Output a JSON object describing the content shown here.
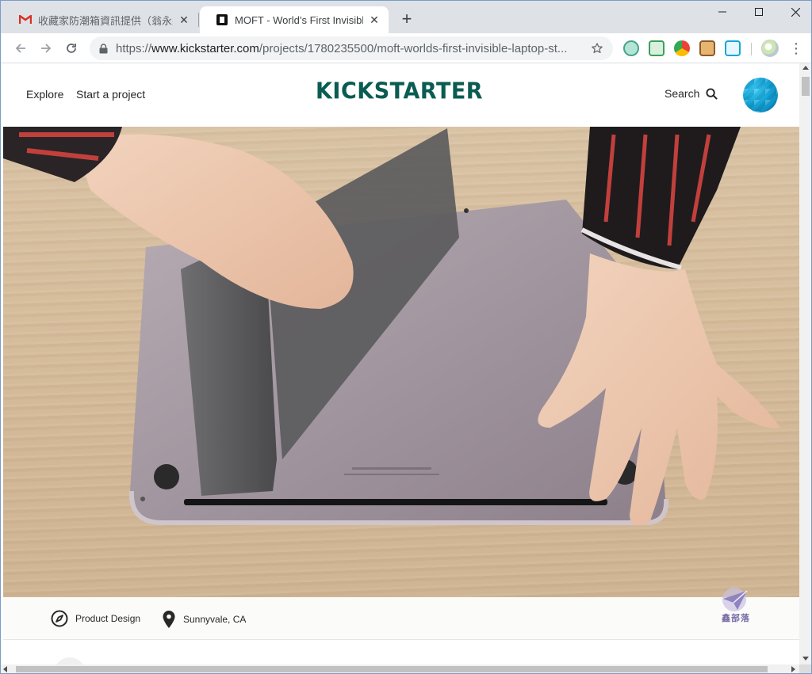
{
  "browser": {
    "tabs": [
      {
        "title": "收藏家防潮箱資訊提供（翁永鑫",
        "favicon": "gmail-icon",
        "active": false
      },
      {
        "title": "MOFT - World’s First Invisible Laptop Stand",
        "favicon": "kickstarter-icon",
        "active": true
      }
    ],
    "new_tab_label": "+",
    "address": {
      "scheme": "https://",
      "host": "www.kickstarter.com",
      "path": "/projects/1780235500/moft-worlds-first-invisible-laptop-st..."
    }
  },
  "site": {
    "nav": {
      "explore": "Explore",
      "start_project": "Start a project"
    },
    "logo": "KICKSTARTER",
    "search_label": "Search"
  },
  "project": {
    "category": "Product Design",
    "location": "Sunnyvale, CA"
  },
  "watermark": {
    "text": "鑫部落"
  },
  "colors": {
    "logo": "#0a5c52",
    "avatar": "#15a3d6",
    "tab_strip": "#dee1e6"
  }
}
